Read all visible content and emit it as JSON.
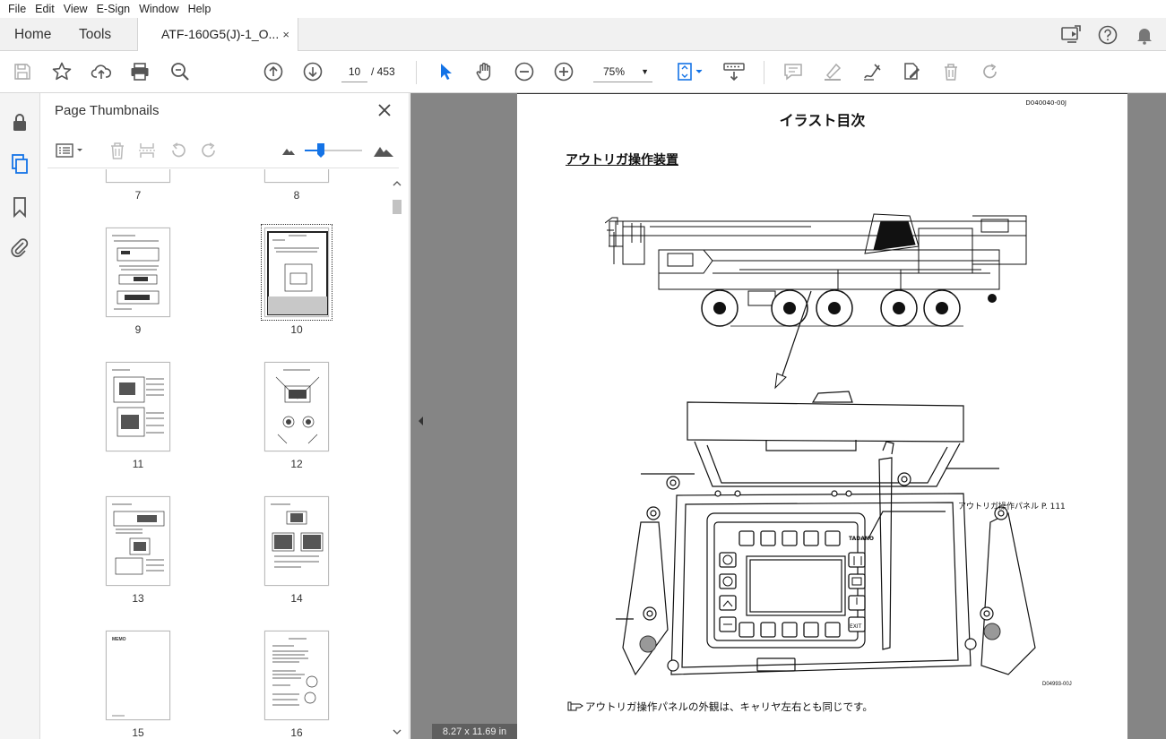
{
  "menu": [
    "File",
    "Edit",
    "View",
    "E-Sign",
    "Window",
    "Help"
  ],
  "tabs": {
    "home": "Home",
    "tools": "Tools",
    "document": "ATF-160G5(J)-1_O...",
    "close": "×"
  },
  "toolbar": {
    "current_page": "10",
    "total_pages": "/ 453",
    "zoom": "75%"
  },
  "panel": {
    "title": "Page Thumbnails",
    "selected_page": "10",
    "thumbnails": [
      {
        "label": "7"
      },
      {
        "label": "8"
      },
      {
        "label": "9"
      },
      {
        "label": "10"
      },
      {
        "label": "11"
      },
      {
        "label": "12"
      },
      {
        "label": "13"
      },
      {
        "label": "14"
      },
      {
        "label": "15"
      },
      {
        "label": "16"
      }
    ],
    "memo_label": "MEMO"
  },
  "page": {
    "code": "D040040-00J",
    "title": "イラスト目次",
    "section": "アウトリガ操作装置",
    "callout": "アウトリガ操作パネル P. 111",
    "figure_code": "D04993-00J",
    "note": "アウトリガ操作パネルの外観は、キャリヤ左右とも同じです。",
    "panel_label_exit": "EXIT",
    "brand": "TADANO"
  },
  "status": {
    "page_size": "8.27 x 11.69 in"
  },
  "colors": {
    "accent": "#1473e6",
    "tab_bar": "#f1f1f1",
    "doc_background": "#858585"
  }
}
